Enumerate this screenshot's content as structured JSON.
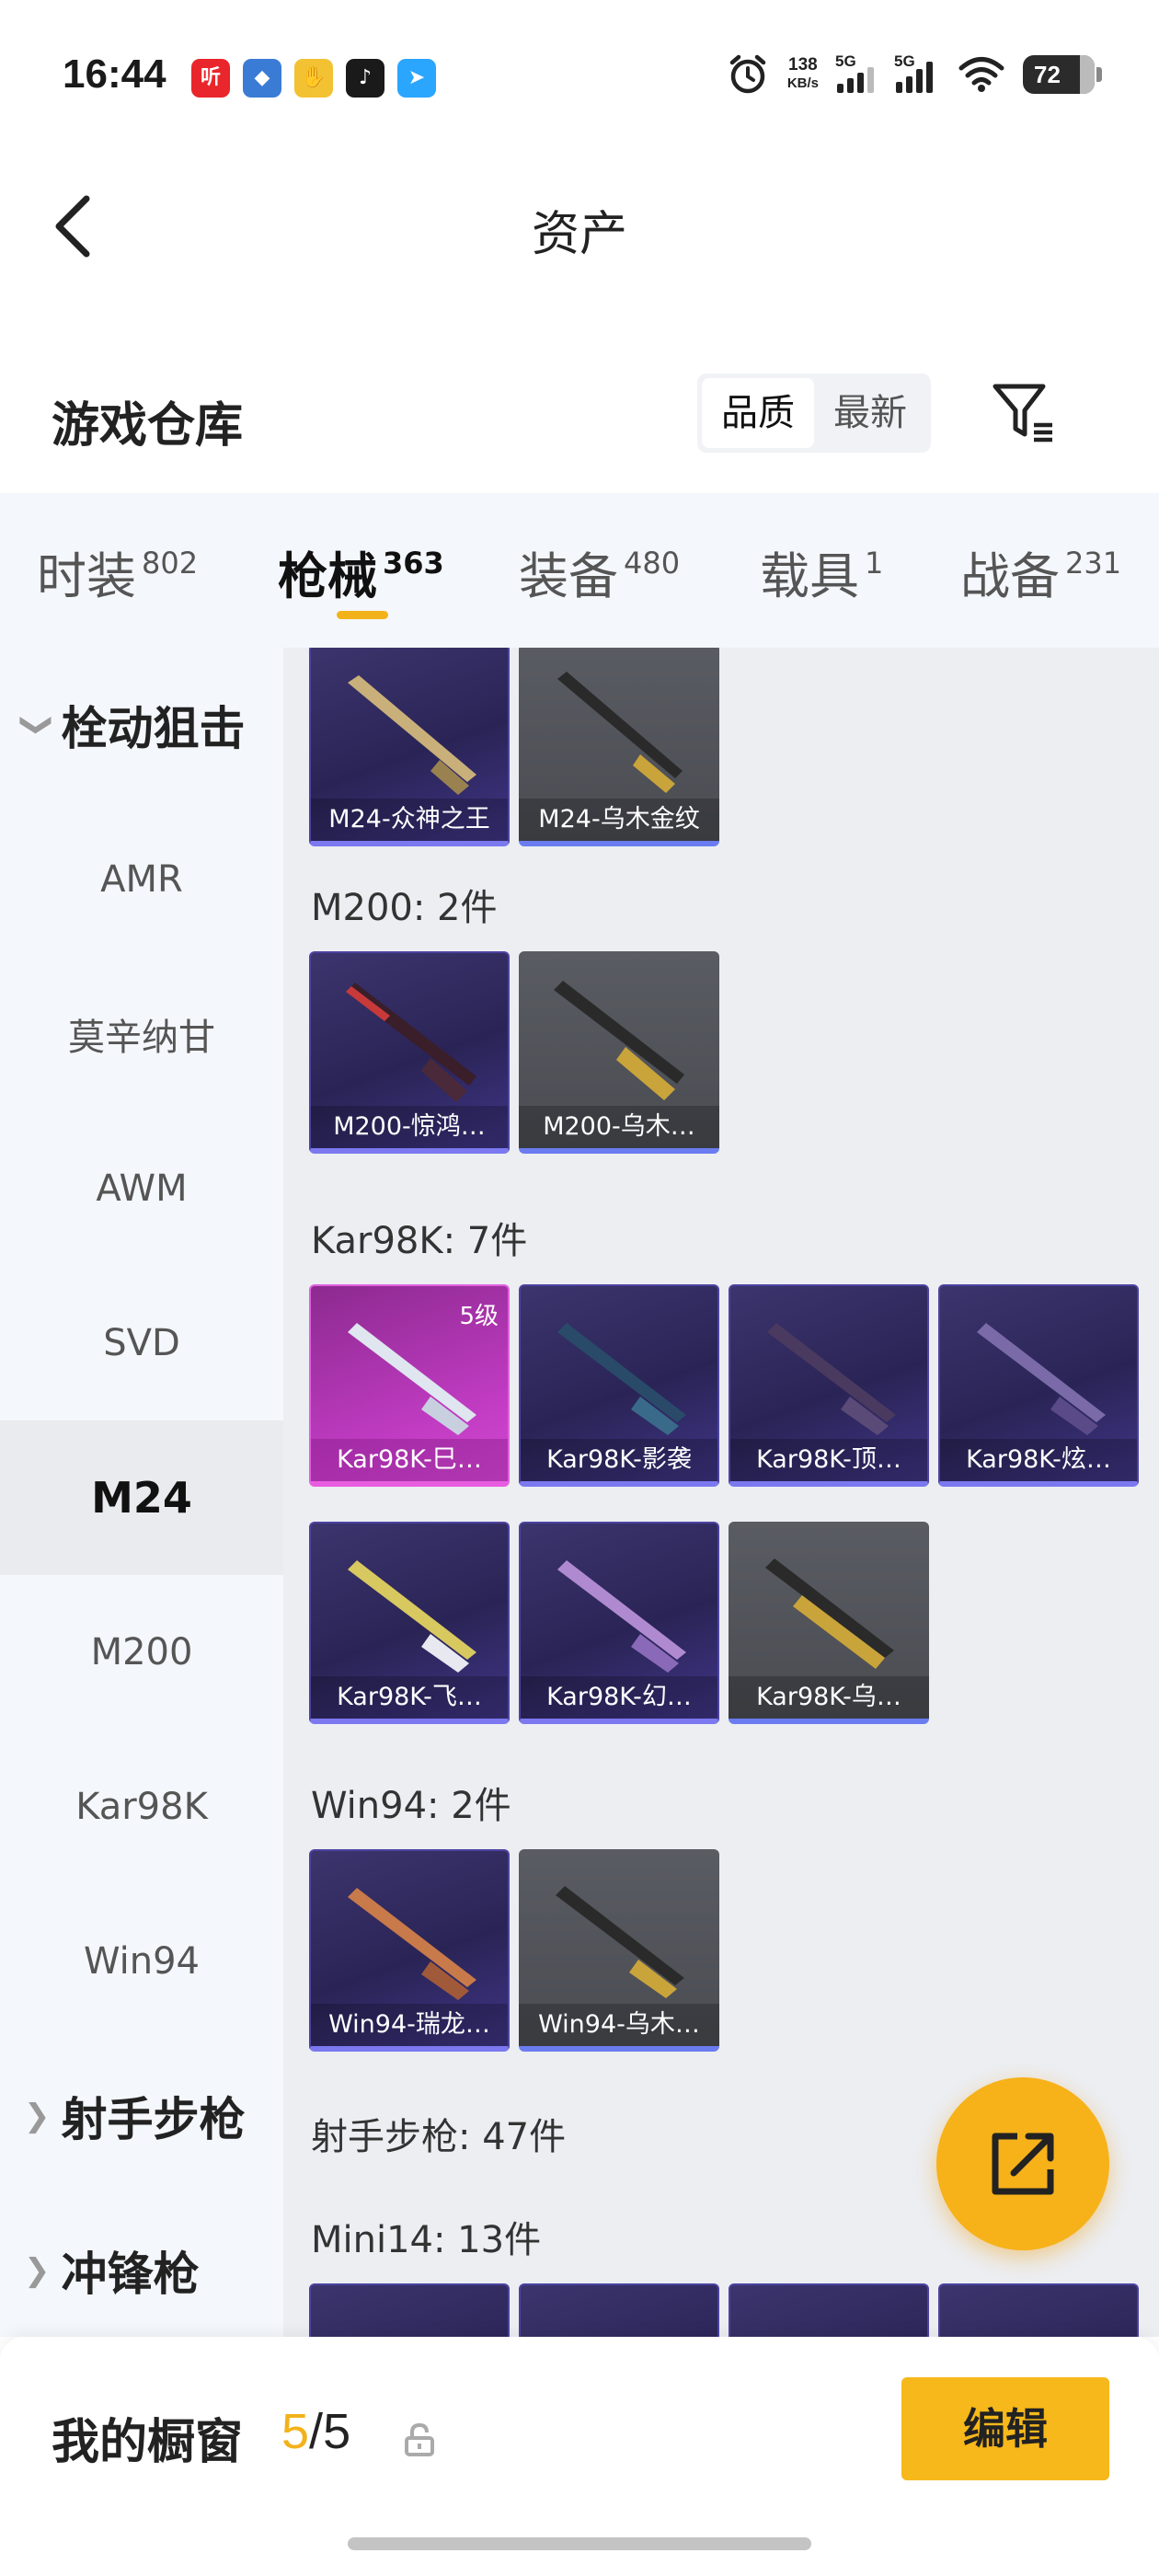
{
  "status_bar": {
    "time": "16:44",
    "apps": [
      {
        "icon": "ting-app-icon",
        "glyph": "听",
        "color": "#e8262b"
      },
      {
        "icon": "chat-app-icon",
        "glyph": "◆",
        "color": "#3a7bd5"
      },
      {
        "icon": "yellow-app-icon",
        "glyph": "✋",
        "color": "#f2c232"
      },
      {
        "icon": "douyin-app-icon",
        "glyph": "♪",
        "color": "#1a1a1a"
      },
      {
        "icon": "send-app-icon",
        "glyph": "➤",
        "color": "#2aa6ff"
      }
    ],
    "net_speed": "138",
    "net_unit": "KB/s",
    "sig1_label": "5G",
    "sig2_label": "5G",
    "battery": "72"
  },
  "nav": {
    "title": "资产"
  },
  "header": {
    "title": "游戏仓库",
    "sort_options": [
      "品质",
      "最新"
    ],
    "active_sort": "品质"
  },
  "tabs": [
    {
      "label": "时装",
      "count": "802"
    },
    {
      "label": "枪械",
      "count": "363"
    },
    {
      "label": "装备",
      "count": "480"
    },
    {
      "label": "载具",
      "count": "1"
    },
    {
      "label": "战备",
      "count": "231"
    }
  ],
  "sidebar": {
    "group1": "栓动狙击",
    "items": [
      "AMR",
      "莫辛纳甘",
      "AWM",
      "SVD",
      "M24",
      "M200",
      "Kar98K",
      "Win94"
    ],
    "active": "M24",
    "group2": "射手步枪",
    "group3": "冲锋枪"
  },
  "sections": {
    "m24": {
      "cards": [
        "M24-众神之王",
        "M24-乌木金纹"
      ]
    },
    "m200": {
      "title": "M200: 2件",
      "cards": [
        "M200-惊鸿…",
        "M200-乌木…"
      ]
    },
    "kar98k": {
      "title": "Kar98K: 7件",
      "level": "5级",
      "cards": [
        "Kar98K-巳…",
        "Kar98K-影袭",
        "Kar98K-顶…",
        "Kar98K-炫…",
        "Kar98K-飞…",
        "Kar98K-幻…",
        "Kar98K-乌…"
      ]
    },
    "win94": {
      "title": "Win94: 2件",
      "cards": [
        "Win94-瑞龙…",
        "Win94-乌木…"
      ]
    },
    "dmr": {
      "title": "射手步枪: 47件"
    },
    "mini14": {
      "title": "Mini14: 13件"
    }
  },
  "bottom": {
    "label": "我的橱窗",
    "current": "5",
    "separator": "/",
    "total": "5",
    "edit": "编辑"
  },
  "colors": {
    "accent": "#f2b21a",
    "card_purple": "#2a2456",
    "card_gray": "#4f5157",
    "card_pink": "#c23cc4"
  }
}
